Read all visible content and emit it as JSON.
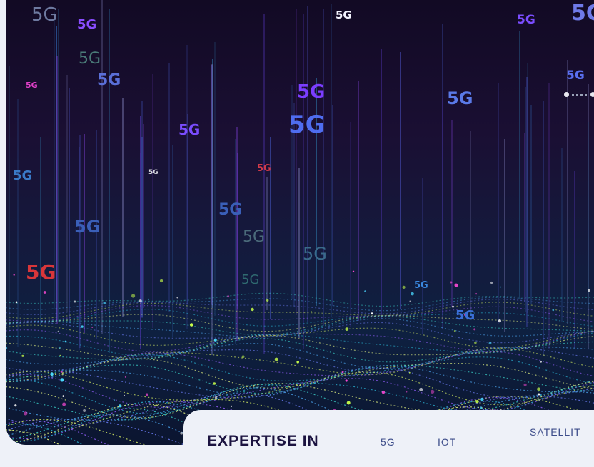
{
  "hero": {
    "tags": [
      {
        "text": "5G"
      },
      {
        "text": "5G"
      },
      {
        "text": "5G"
      },
      {
        "text": "5G"
      },
      {
        "text": "5G"
      },
      {
        "text": "5G"
      },
      {
        "text": "5G"
      },
      {
        "text": "5G"
      },
      {
        "text": "5G"
      },
      {
        "text": "5G"
      },
      {
        "text": "5G"
      },
      {
        "text": "5G"
      },
      {
        "text": "5G"
      },
      {
        "text": "5G"
      },
      {
        "text": "5G"
      },
      {
        "text": "5G"
      },
      {
        "text": "5G"
      },
      {
        "text": "5G"
      },
      {
        "text": "5G"
      },
      {
        "text": "5G"
      },
      {
        "text": "5G"
      },
      {
        "text": "5G"
      },
      {
        "text": "5G"
      },
      {
        "text": "5G"
      }
    ]
  },
  "carousel": {
    "slide_count": 3,
    "active_index": 0
  },
  "expertise": {
    "title": "EXPERTISE IN",
    "items": [
      "5G",
      "IOT",
      "SATELLIT"
    ]
  },
  "colors": {
    "title": "#1b1340",
    "chip": "#3d4d8a",
    "background": "#eef1f8"
  }
}
